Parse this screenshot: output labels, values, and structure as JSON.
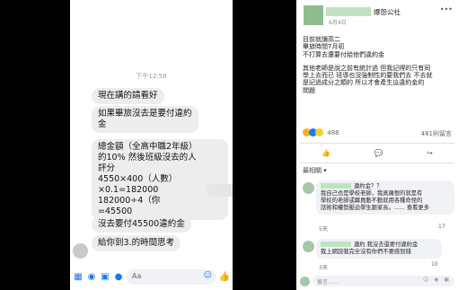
{
  "messenger": {
    "timestamp": "下午12:58",
    "bubbles": [
      {
        "lines": [
          "現在講的請看好"
        ]
      },
      {
        "lines": [
          "如果畢旅沒去是要付違約",
          "金"
        ]
      },
      {
        "lines": [
          "總金額（全高中職2年級）",
          "的10% 然後班級沒去的人",
          "評分",
          "4550×400（人數）",
          "×0.1=182000",
          "182000÷4（你",
          "=45500"
        ]
      },
      {
        "lines": [
          "沒去要付45500違約金"
        ]
      },
      {
        "lines": [
          "給你到3.的時間思考"
        ]
      }
    ],
    "composer": {
      "placeholder": "Aa",
      "icons": [
        "grid-icon",
        "camera-icon",
        "image-icon",
        "mic-icon",
        "smile-icon",
        "like-icon"
      ]
    }
  },
  "facebook": {
    "page_name": "爆怨公社",
    "post_date": "6月4日",
    "post_text_block1": [
      "目前就讀高二",
      "畢旅時間7月初",
      "不打算去還要付給他們違約金"
    ],
    "post_text_block2": [
      "其他老師是說之前有統計過 但我記得的只有同",
      "學上去而已 班導也沒強制性的要我們去 不去就",
      "是記過成分之類的 所以才會產生這違約金的",
      "問題"
    ],
    "reactions": {
      "count": "488",
      "comments": "481則留言"
    },
    "actions": [
      "like-icon",
      "comment-icon",
      "share-icon"
    ],
    "sort_label": "最相關",
    "comments": [
      {
        "lines": [
          "違約金？？",
          "我自己也是學校老師，我真痛恨的就是有",
          "學校的老師或職員動不動就用各種奇怪的",
          "話術和權勢壓迫學生跟家長。...... 查看更多"
        ],
        "time": "5天",
        "count": "17"
      },
      {
        "lines": [
          "違約 我沒去還要付違約金",
          "我上網說我完全沒有你們不要感到錢"
        ],
        "time": "3天",
        "count": "10"
      }
    ],
    "write_placeholder": "留言……"
  }
}
